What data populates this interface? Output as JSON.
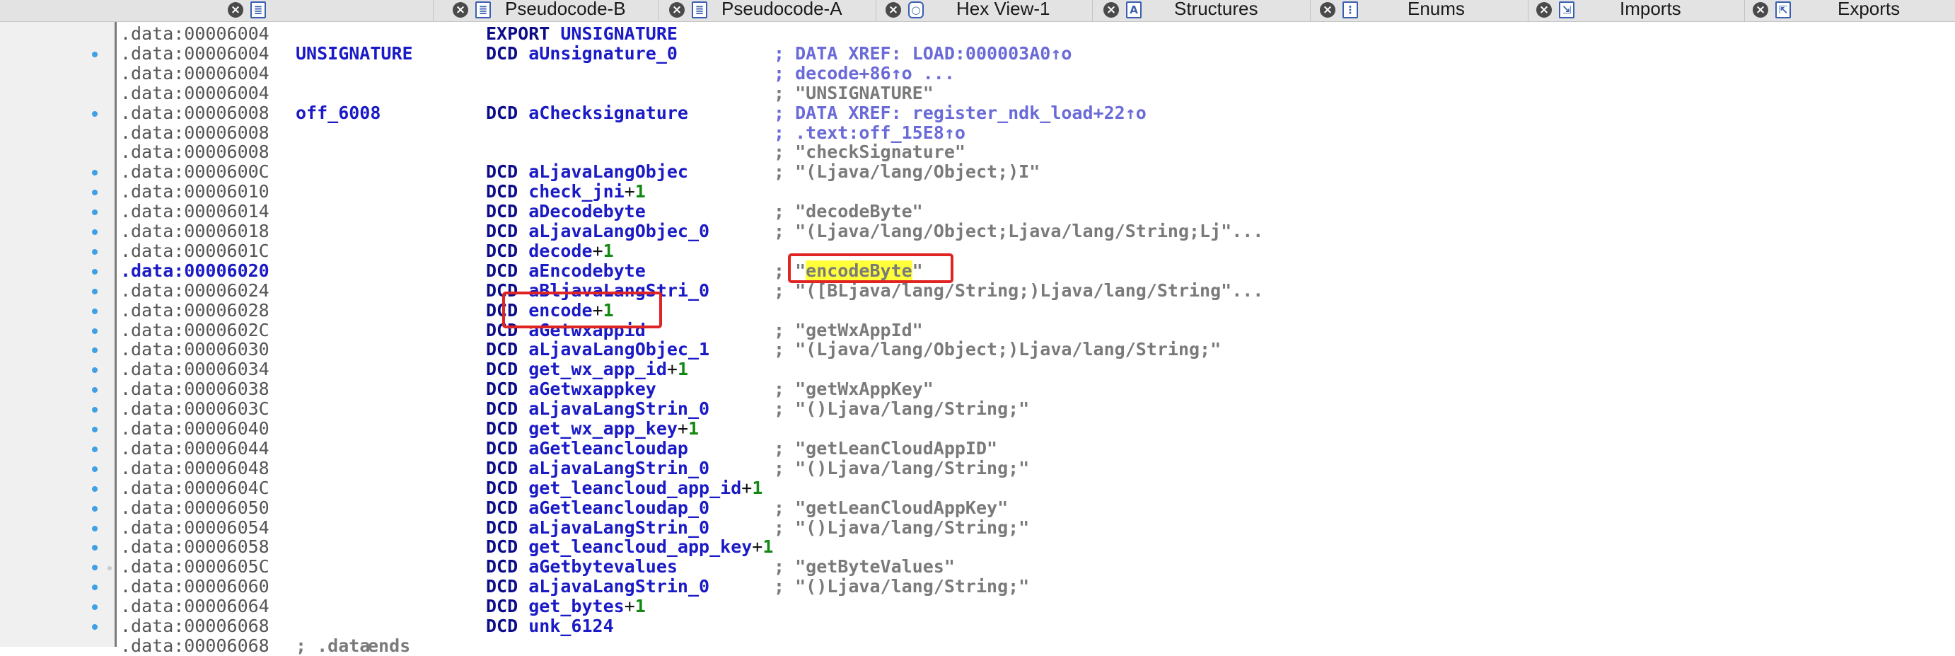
{
  "tabs": [
    {
      "label": "",
      "icon": "pseudocode-icon"
    },
    {
      "label": "Pseudocode-B",
      "icon": "pseudocode-icon"
    },
    {
      "label": "Pseudocode-A",
      "icon": "pseudocode-icon"
    },
    {
      "label": "Hex View-1",
      "icon": "hex-view-icon"
    },
    {
      "label": "Structures",
      "icon": "structures-icon"
    },
    {
      "label": "Enums",
      "icon": "enums-icon"
    },
    {
      "label": "Imports",
      "icon": "imports-icon"
    },
    {
      "label": "Exports",
      "icon": "exports-icon"
    }
  ],
  "listing": {
    "current_address": ".data:00006020",
    "lines": [
      {
        "addr": ".data:00006004",
        "bullet": false,
        "label": "",
        "op": "EXPORT",
        "operand": "UNSIGNATURE",
        "plus": "",
        "num": "",
        "comment": ""
      },
      {
        "addr": ".data:00006004",
        "bullet": true,
        "label": "UNSIGNATURE",
        "op": "DCD",
        "operand": "aUnsignature_0",
        "plus": "",
        "num": "",
        "comment": "; DATA XREF: LOAD:000003A0↑o"
      },
      {
        "addr": ".data:00006004",
        "bullet": false,
        "label": "",
        "op": "",
        "operand": "",
        "plus": "",
        "num": "",
        "comment": "; decode+86↑o ..."
      },
      {
        "addr": ".data:00006004",
        "bullet": false,
        "label": "",
        "op": "",
        "operand": "",
        "plus": "",
        "num": "",
        "comment": "; \"UNSIGNATURE\""
      },
      {
        "addr": ".data:00006008",
        "bullet": true,
        "label": "off_6008",
        "op": "DCD",
        "operand": "aChecksignature",
        "plus": "",
        "num": "",
        "comment": "; DATA XREF: register_ndk_load+22↑o"
      },
      {
        "addr": ".data:00006008",
        "bullet": false,
        "label": "",
        "op": "",
        "operand": "",
        "plus": "",
        "num": "",
        "comment": "; .text:off_15E8↑o"
      },
      {
        "addr": ".data:00006008",
        "bullet": false,
        "label": "",
        "op": "",
        "operand": "",
        "plus": "",
        "num": "",
        "comment": "; \"checkSignature\""
      },
      {
        "addr": ".data:0000600C",
        "bullet": true,
        "label": "",
        "op": "DCD",
        "operand": "aLjavaLangObjec",
        "plus": "",
        "num": "",
        "comment": "; \"(Ljava/lang/Object;)I\""
      },
      {
        "addr": ".data:00006010",
        "bullet": true,
        "label": "",
        "op": "DCD",
        "operand": "check_jni",
        "plus": "+",
        "num": "1",
        "comment": ""
      },
      {
        "addr": ".data:00006014",
        "bullet": true,
        "label": "",
        "op": "DCD",
        "operand": "aDecodebyte",
        "plus": "",
        "num": "",
        "comment": "; \"decodeByte\""
      },
      {
        "addr": ".data:00006018",
        "bullet": true,
        "label": "",
        "op": "DCD",
        "operand": "aLjavaLangObjec_0",
        "plus": "",
        "num": "",
        "comment": "; \"(Ljava/lang/Object;Ljava/lang/String;Lj\"..."
      },
      {
        "addr": ".data:0000601C",
        "bullet": true,
        "label": "",
        "op": "DCD",
        "operand": "decode",
        "plus": "+",
        "num": "1",
        "comment": ""
      },
      {
        "addr": ".data:00006020",
        "bullet": true,
        "label": "",
        "op": "DCD",
        "operand": "aEncodebyte",
        "plus": "",
        "num": "",
        "comment": "; \"encodeByte\""
      },
      {
        "addr": ".data:00006024",
        "bullet": true,
        "label": "",
        "op": "DCD",
        "operand": "aBljavaLangStri_0",
        "plus": "",
        "num": "",
        "comment": "; \"([BLjava/lang/String;)Ljava/lang/String\"..."
      },
      {
        "addr": ".data:00006028",
        "bullet": true,
        "label": "",
        "op": "DCD",
        "operand": "encode",
        "plus": "+",
        "num": "1",
        "comment": ""
      },
      {
        "addr": ".data:0000602C",
        "bullet": true,
        "label": "",
        "op": "DCD",
        "operand": "aGetwxappid",
        "plus": "",
        "num": "",
        "comment": "; \"getWxAppId\""
      },
      {
        "addr": ".data:00006030",
        "bullet": true,
        "label": "",
        "op": "DCD",
        "operand": "aLjavaLangObjec_1",
        "plus": "",
        "num": "",
        "comment": "; \"(Ljava/lang/Object;)Ljava/lang/String;\""
      },
      {
        "addr": ".data:00006034",
        "bullet": true,
        "label": "",
        "op": "DCD",
        "operand": "get_wx_app_id",
        "plus": "+",
        "num": "1",
        "comment": ""
      },
      {
        "addr": ".data:00006038",
        "bullet": true,
        "label": "",
        "op": "DCD",
        "operand": "aGetwxappkey",
        "plus": "",
        "num": "",
        "comment": "; \"getWxAppKey\""
      },
      {
        "addr": ".data:0000603C",
        "bullet": true,
        "label": "",
        "op": "DCD",
        "operand": "aLjavaLangStrin_0",
        "plus": "",
        "num": "",
        "comment": "; \"()Ljava/lang/String;\""
      },
      {
        "addr": ".data:00006040",
        "bullet": true,
        "label": "",
        "op": "DCD",
        "operand": "get_wx_app_key",
        "plus": "+",
        "num": "1",
        "comment": ""
      },
      {
        "addr": ".data:00006044",
        "bullet": true,
        "label": "",
        "op": "DCD",
        "operand": "aGetleancloudap",
        "plus": "",
        "num": "",
        "comment": "; \"getLeanCloudAppID\""
      },
      {
        "addr": ".data:00006048",
        "bullet": true,
        "label": "",
        "op": "DCD",
        "operand": "aLjavaLangStrin_0",
        "plus": "",
        "num": "",
        "comment": "; \"()Ljava/lang/String;\""
      },
      {
        "addr": ".data:0000604C",
        "bullet": true,
        "label": "",
        "op": "DCD",
        "operand": "get_leancloud_app_id",
        "plus": "+",
        "num": "1",
        "comment": ""
      },
      {
        "addr": ".data:00006050",
        "bullet": true,
        "label": "",
        "op": "DCD",
        "operand": "aGetleancloudap_0",
        "plus": "",
        "num": "",
        "comment": "; \"getLeanCloudAppKey\""
      },
      {
        "addr": ".data:00006054",
        "bullet": true,
        "label": "",
        "op": "DCD",
        "operand": "aLjavaLangStrin_0",
        "plus": "",
        "num": "",
        "comment": "; \"()Ljava/lang/String;\""
      },
      {
        "addr": ".data:00006058",
        "bullet": true,
        "label": "",
        "op": "DCD",
        "operand": "get_leancloud_app_key",
        "plus": "+",
        "num": "1",
        "comment": ""
      },
      {
        "addr": ".data:0000605C",
        "bullet": true,
        "label": "",
        "op": "DCD",
        "operand": "aGetbytevalues",
        "plus": "",
        "num": "",
        "comment": "; \"getByteValues\""
      },
      {
        "addr": ".data:00006060",
        "bullet": true,
        "label": "",
        "op": "DCD",
        "operand": "aLjavaLangStrin_0",
        "plus": "",
        "num": "",
        "comment": "; \"()Ljava/lang/String;\""
      },
      {
        "addr": ".data:00006064",
        "bullet": true,
        "label": "",
        "op": "DCD",
        "operand": "get_bytes",
        "plus": "+",
        "num": "1",
        "comment": ""
      },
      {
        "addr": ".data:00006068",
        "bullet": true,
        "label": "",
        "op": "DCD",
        "operand": "unk_6124",
        "plus": "",
        "num": "",
        "comment": ""
      },
      {
        "addr": ".data:00006068",
        "bullet": false,
        "label": "; .data",
        "op": "ends",
        "operand": "",
        "plus": "",
        "num": "",
        "comment": ""
      }
    ]
  },
  "colors": {
    "address": "#555555",
    "identifier": "#1a1ac6",
    "mnemonic": "#0c0c8a",
    "number": "#118811",
    "comment": "#7a7a7a",
    "xref": "#6a6ad8",
    "highlight": "#ffff3a",
    "annotation_box": "#e02424"
  }
}
